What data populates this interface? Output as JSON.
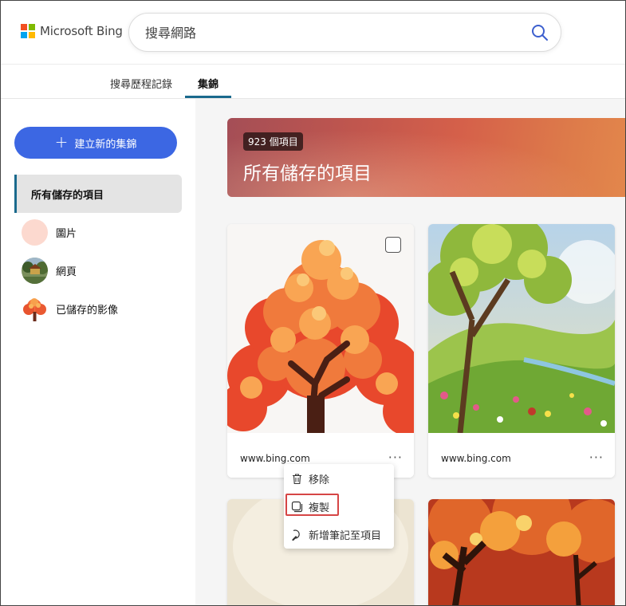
{
  "header": {
    "logo_text": "Microsoft Bing",
    "search_placeholder": "搜尋網路"
  },
  "tabs": [
    {
      "label": "搜尋歷程記錄",
      "active": false
    },
    {
      "label": "集錦",
      "active": true
    }
  ],
  "sidebar": {
    "create_label": "建立新的集錦",
    "active_item": "所有儲存的項目",
    "items": [
      {
        "label": "圖片",
        "icon": "pink-circle"
      },
      {
        "label": "網頁",
        "icon": "webpage-thumbnail"
      },
      {
        "label": "已儲存的影像",
        "icon": "autumn-tree-thumbnail"
      }
    ]
  },
  "banner": {
    "count": "923 個項目",
    "title": "所有儲存的項目"
  },
  "cards": [
    {
      "source": "www.bing.com",
      "more": "···",
      "image": "autumn-tree-illustration"
    },
    {
      "source": "www.bing.com",
      "more": "···",
      "image": "spring-landscape-painting"
    }
  ],
  "context_menu": {
    "items": [
      {
        "label": "移除",
        "icon": "trash-icon"
      },
      {
        "label": "複製",
        "icon": "copy-icon",
        "highlighted": true
      },
      {
        "label": "新增筆記至項目",
        "icon": "note-icon"
      }
    ]
  },
  "colors": {
    "accent": "#3c67e3",
    "tab_underline": "#1a6a8d",
    "highlight": "#d64545"
  }
}
